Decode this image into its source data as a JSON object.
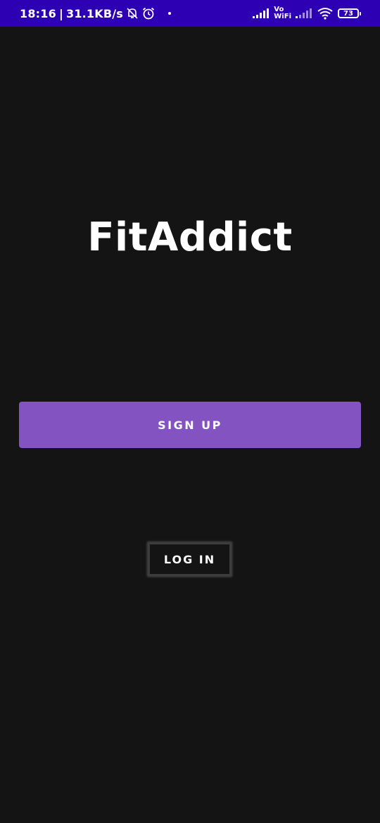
{
  "status_bar": {
    "time": "18:16",
    "separator": "|",
    "network_speed": "31.1KB/s",
    "vowifi_top": "Vo",
    "vowifi_bottom": "WiFi",
    "battery_level": "73",
    "icons": [
      "bell-off-icon",
      "alarm-icon",
      "signal-icon",
      "wifi-icon",
      "battery-icon"
    ],
    "background_color": "#2e00b4"
  },
  "app": {
    "title": "FitAddict",
    "background_color": "#141414"
  },
  "actions": {
    "signup_label": "SIGN UP",
    "signup_color": "#8453c2",
    "login_label": "LOG IN"
  }
}
